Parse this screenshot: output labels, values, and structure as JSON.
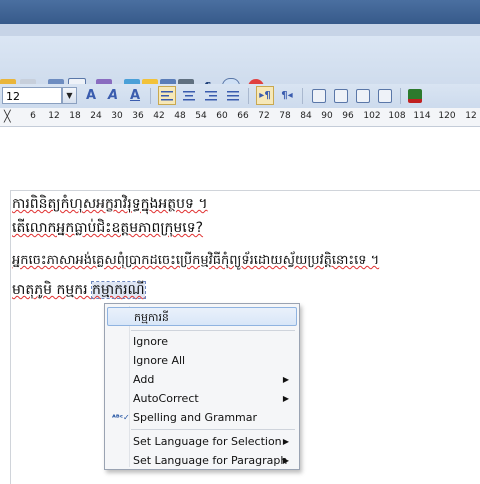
{
  "ruler": {
    "ticks": [
      "6",
      "12",
      "18",
      "24",
      "30",
      "36",
      "42",
      "48",
      "54",
      "60",
      "66",
      "72",
      "78",
      "84",
      "90",
      "96",
      "102",
      "108",
      "114",
      "120",
      "12"
    ]
  },
  "formatting": {
    "font_size": "12"
  },
  "document": {
    "lines": [
      "ការពិនិត្យកំហុសអក្ខរាវិរុទ្ធក្នុងអត្ថបទ ។",
      "តើលោកអ្នកធ្លាប់ជិះឧត្តមភាពក្រុមទេ?",
      "អ្នកចេះភាសាអង់គ្លេសពុំប្រាកដចេះប្រើកម្មវិធីកុំព្យូទ័រដោយស្វ័យប្រវត្តិនោះទេ ។"
    ],
    "line4": {
      "plain": "មាតុភូមិ កម្មករ ",
      "selected": "កម្មាករណី"
    }
  },
  "context_menu": {
    "suggestion": "កម្មការនី",
    "items": [
      {
        "label": "Ignore"
      },
      {
        "label": "Ignore All"
      },
      {
        "label": "Add",
        "submenu": true
      },
      {
        "label": "AutoCorrect",
        "submenu": true
      },
      {
        "label": "Spelling and Grammar",
        "icon": "spellcheck-icon"
      },
      {
        "label": "Set Language for Selection",
        "submenu": true
      },
      {
        "label": "Set Language for Paragraph",
        "submenu": true
      }
    ]
  },
  "colors": {
    "accent": "#3a5cae",
    "highlight": "#d8e6f8",
    "spell_error": "#e03030"
  }
}
